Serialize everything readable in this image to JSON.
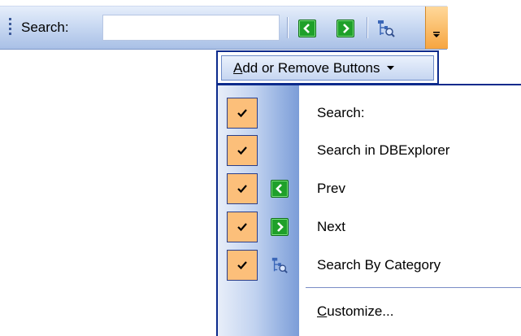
{
  "toolbar": {
    "search_label": "Search:",
    "search_value": "",
    "buttons": [
      {
        "name": "prev",
        "icon": "green-left-arrow-icon"
      },
      {
        "name": "next",
        "icon": "green-right-arrow-icon"
      },
      {
        "name": "search-by-category",
        "icon": "tree-search-icon"
      }
    ],
    "overflow_icon": "chevron-down-icon"
  },
  "add_remove": {
    "label_first": "A",
    "label_rest": "dd or Remove Buttons"
  },
  "menu": {
    "items": [
      {
        "label": "Search:",
        "checked": true,
        "icon": ""
      },
      {
        "label": "Search in DBExplorer",
        "checked": true,
        "icon": ""
      },
      {
        "label": "Prev",
        "checked": true,
        "icon": "green-left-arrow-icon"
      },
      {
        "label": "Next",
        "checked": true,
        "icon": "green-right-arrow-icon"
      },
      {
        "label": "Search By Category",
        "checked": true,
        "icon": "tree-search-icon"
      }
    ],
    "customize_first": "C",
    "customize_rest": "ustomize..."
  },
  "colors": {
    "check_bg": "#fcbf7a",
    "menu_border": "#0b2a8c",
    "toolbar_accent": "#f6a540"
  }
}
